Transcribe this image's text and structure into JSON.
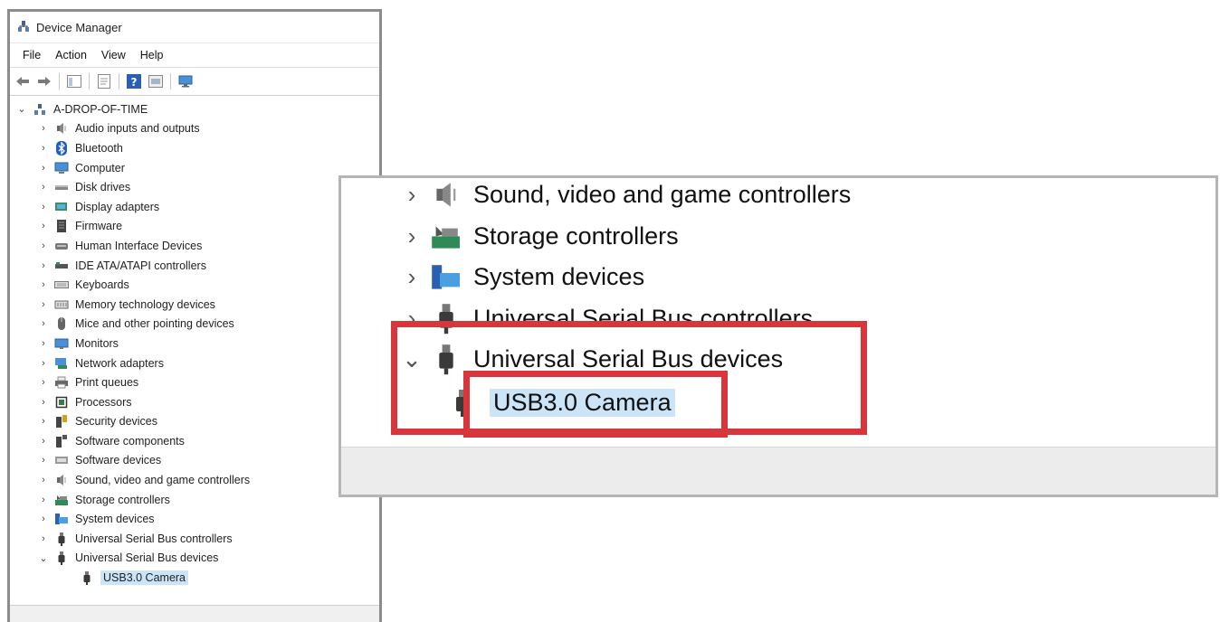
{
  "window": {
    "title": "Device Manager"
  },
  "menu": [
    "File",
    "Action",
    "View",
    "Help"
  ],
  "tree": {
    "root": "A-DROP-OF-TIME",
    "categories": [
      {
        "label": "Audio inputs and outputs",
        "icon": "speaker-icon"
      },
      {
        "label": "Bluetooth",
        "icon": "bluetooth-icon"
      },
      {
        "label": "Computer",
        "icon": "computer-icon"
      },
      {
        "label": "Disk drives",
        "icon": "disk-drive-icon"
      },
      {
        "label": "Display adapters",
        "icon": "display-adapter-icon"
      },
      {
        "label": "Firmware",
        "icon": "firmware-icon"
      },
      {
        "label": "Human Interface Devices",
        "icon": "hid-icon"
      },
      {
        "label": "IDE ATA/ATAPI controllers",
        "icon": "ide-controller-icon"
      },
      {
        "label": "Keyboards",
        "icon": "keyboard-icon"
      },
      {
        "label": "Memory technology devices",
        "icon": "memory-icon"
      },
      {
        "label": "Mice and other pointing devices",
        "icon": "mouse-icon"
      },
      {
        "label": "Monitors",
        "icon": "monitor-icon"
      },
      {
        "label": "Network adapters",
        "icon": "network-adapter-icon"
      },
      {
        "label": "Print queues",
        "icon": "printer-icon"
      },
      {
        "label": "Processors",
        "icon": "processor-icon"
      },
      {
        "label": "Security devices",
        "icon": "security-device-icon"
      },
      {
        "label": "Software components",
        "icon": "software-component-icon"
      },
      {
        "label": "Software devices",
        "icon": "software-device-icon"
      },
      {
        "label": "Sound, video and game controllers",
        "icon": "speaker-icon"
      },
      {
        "label": "Storage controllers",
        "icon": "storage-controller-icon"
      },
      {
        "label": "System devices",
        "icon": "system-device-icon"
      },
      {
        "label": "Universal Serial Bus controllers",
        "icon": "usb-icon"
      },
      {
        "label": "Universal Serial Bus devices",
        "icon": "usb-icon",
        "expanded": true
      }
    ],
    "child": {
      "label": "USB3.0 Camera",
      "icon": "usb-icon"
    }
  },
  "zoom": {
    "rows": [
      {
        "label": "Sound, video and game controllers",
        "icon": "speaker-icon"
      },
      {
        "label": "Storage controllers",
        "icon": "storage-controller-icon"
      },
      {
        "label": "System devices",
        "icon": "system-device-icon"
      },
      {
        "label": "Universal Serial Bus controllers",
        "icon": "usb-icon"
      },
      {
        "label": "Universal Serial Bus devices",
        "icon": "usb-icon",
        "expanded": true
      }
    ],
    "child": {
      "label": "USB3.0 Camera",
      "icon": "usb-icon"
    }
  },
  "colors": {
    "highlight": "#d9363b",
    "selection": "#cce4f7",
    "window_border": "#8c8c8c"
  }
}
